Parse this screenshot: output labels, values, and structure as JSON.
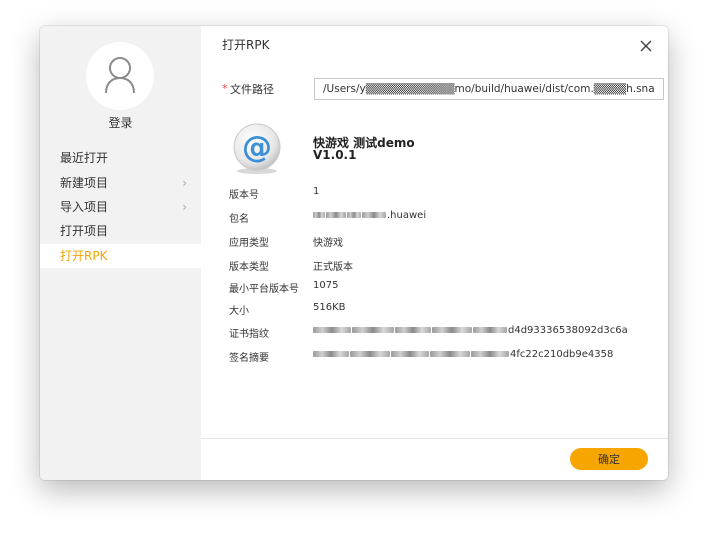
{
  "sidebar": {
    "login_label": "登录",
    "items": [
      {
        "label": "最近打开",
        "has_submenu": false,
        "active": false
      },
      {
        "label": "新建项目",
        "has_submenu": true,
        "active": false
      },
      {
        "label": "导入项目",
        "has_submenu": true,
        "active": false
      },
      {
        "label": "打开项目",
        "has_submenu": false,
        "active": false
      },
      {
        "label": "打开RPK",
        "has_submenu": false,
        "active": true
      }
    ],
    "chevron": "›"
  },
  "dialog": {
    "title": "打开RPK",
    "path_required_mark": "*",
    "path_label": "文件路径",
    "path_value": "/Users/y▒▒▒▒▒▒▒▒▒▒▒mo/build/huawei/dist/com.▒▒▒▒h.snake",
    "app_name": "快游戏 测试demo",
    "app_version": "V1.0.1",
    "info": [
      {
        "label": "版本号",
        "value": "1"
      },
      {
        "label": "包名",
        "value": ".huawei"
      },
      {
        "label": "应用类型",
        "value": "快游戏"
      },
      {
        "label": "版本类型",
        "value": "正式版本"
      },
      {
        "label": "最小平台版本号",
        "value": "1075"
      },
      {
        "label": "大小",
        "value": "516KB"
      },
      {
        "label": "证书指纹",
        "value": "d4d93336538092d3c6a"
      },
      {
        "label": "签名摘要",
        "value": "4fc22c210db9e4358"
      }
    ],
    "ok_label": "确定"
  },
  "colors": {
    "accent": "#f7a600",
    "active_text": "#f5a300",
    "sidebar_bg": "#f2f2f2",
    "required": "#e84a4a"
  },
  "icons": {
    "avatar": "user-icon",
    "close": "close-icon",
    "app": "at-sign-icon",
    "submenu": "chevron-right-icon"
  }
}
